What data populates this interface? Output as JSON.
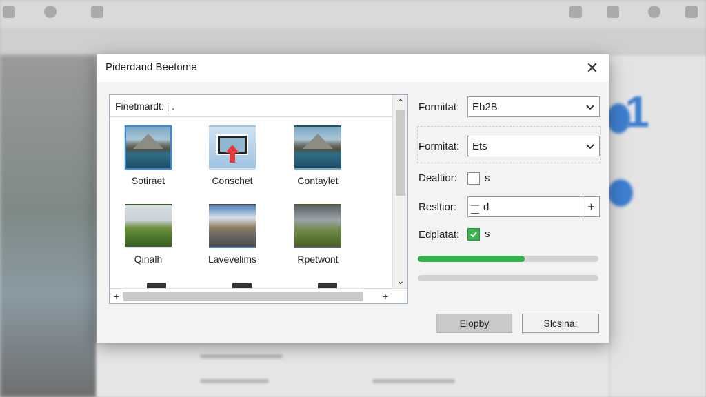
{
  "dialog": {
    "title": "Piderdand Beetome",
    "close_glyph": "✕"
  },
  "browser": {
    "path": "Finetmardt: |  .",
    "tiles": [
      {
        "label": "Sotiraet",
        "thumb": "mountain-lake",
        "selected": true
      },
      {
        "label": "Conschet",
        "thumb": "upload",
        "selected": false
      },
      {
        "label": "Contaylet",
        "thumb": "mountain-lake",
        "selected": false
      },
      {
        "label": "Qinalh",
        "thumb": "green-field",
        "selected": false
      },
      {
        "label": "Lavevelims",
        "thumb": "road-landscape",
        "selected": false
      },
      {
        "label": "Rpetwont",
        "thumb": "cloudy-field",
        "selected": false
      }
    ],
    "scroll_up": "⌃",
    "scroll_down": "⌄",
    "scroll_left": "+",
    "scroll_right": "+"
  },
  "form": {
    "format1": {
      "label": "Formitat:",
      "value": "Eb2B"
    },
    "format2": {
      "label": "Formitat:",
      "value": "Ets"
    },
    "dealution": {
      "label": "Dealtior:",
      "checked": false,
      "suffix": "s"
    },
    "resolution": {
      "label": "Resltior:",
      "value": "d",
      "plus": "+"
    },
    "edplatat": {
      "label": "Edplatat:",
      "checked": true,
      "suffix": "s"
    },
    "progress1": 0.59,
    "progress2": 0.0
  },
  "buttons": {
    "primary": "Elopby",
    "secondary": "Slcsina:"
  },
  "icons": {
    "chevron": "chevron-down-icon",
    "check": "check-icon",
    "close": "close-icon"
  },
  "colors": {
    "accent": "#3b86d6",
    "progress": "#33b24a"
  }
}
